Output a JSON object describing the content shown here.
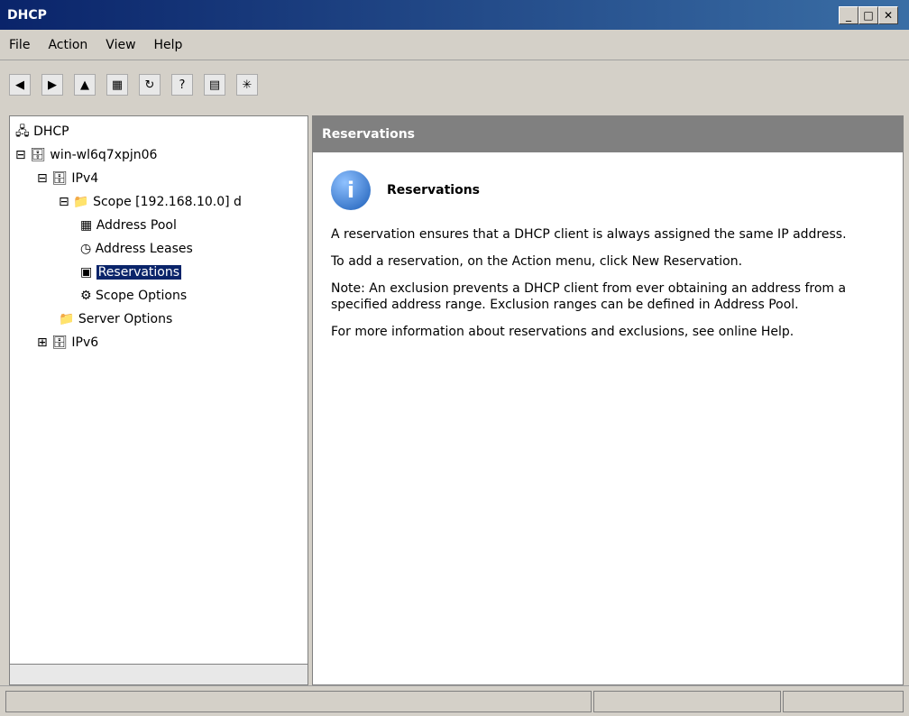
{
  "window": {
    "title": "DHCP",
    "controls": [
      "_",
      "□",
      "✕"
    ]
  },
  "menu": {
    "items": [
      "File",
      "Action",
      "View",
      "Help"
    ]
  },
  "toolbar": {
    "icons": [
      "back-icon",
      "forward-icon",
      "up-icon",
      "show-hide-icon",
      "refresh-icon",
      "help-icon",
      "properties-icon",
      "new-icon"
    ]
  },
  "tree": {
    "root": "DHCP",
    "server": "win-wl6q7xpjn06",
    "ipv4": "IPv4",
    "scope": "Scope [192.168.10.0] d",
    "address_pool": "Address Pool",
    "address_leases": "Address Leases",
    "reservations": "Reservations",
    "scope_options": "Scope Options",
    "server_options": "Server Options",
    "ipv6": "IPv6"
  },
  "right": {
    "header": "Reservations",
    "info_title": "Reservations",
    "p1": "A reservation ensures that a DHCP client is always assigned the same IP address.",
    "p2": "To add a reservation, on the Action menu, click New Reservation.",
    "p3": "Note: An exclusion prevents a DHCP client from ever obtaining an address from a specified address range.  Exclusion ranges can be defined in Address Pool.",
    "p4": "For more information about reservations and exclusions, see online Help."
  }
}
